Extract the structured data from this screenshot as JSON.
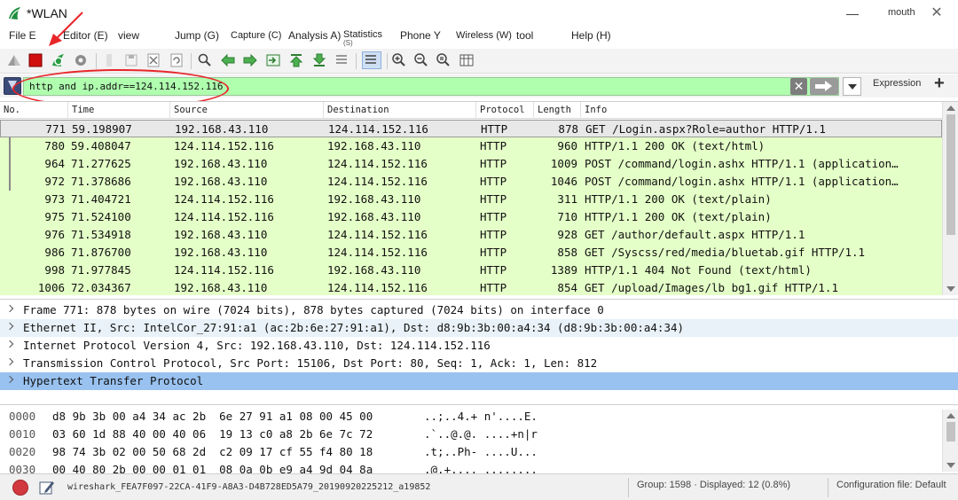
{
  "window": {
    "title": "*WLAN",
    "user": "mouth",
    "minimize_glyph": "—",
    "close_glyph": "✕"
  },
  "menu": {
    "file": "File E",
    "editor": "Editor (E)",
    "view": "view",
    "jump": "Jump (G)",
    "capture": "Capture (C)",
    "analysis": "Analysis A)",
    "statistics": "Statistics",
    "statistics_key": "(S)",
    "phone": "Phone Y",
    "wireless": "Wireless (W)",
    "tool": "tool",
    "help": "Help (H)"
  },
  "toolbar_icons": [
    "shark-fin-icon",
    "stop-capture-icon",
    "restart-capture-icon",
    "capture-options-icon",
    "open-file-icon",
    "save-file-icon",
    "close-file-icon",
    "reload-icon",
    "find-packet-icon",
    "go-back-icon",
    "go-forward-icon",
    "go-to-packet-icon",
    "go-first-icon",
    "go-last-icon",
    "autoscroll-icon",
    "colorize-icon",
    "zoom-in-icon",
    "zoom-out-icon",
    "zoom-normal-icon",
    "resize-columns-icon"
  ],
  "filter": {
    "value": "http and ip.addr==124.114.152.116",
    "clear_glyph": "✕",
    "expression_label": "Expression",
    "add_glyph": "+",
    "background": "#afffaf"
  },
  "packet_columns": [
    "No.",
    "Time",
    "Source",
    "Destination",
    "Protocol",
    "Length",
    "Info"
  ],
  "packets": [
    {
      "no": "771",
      "time": "59.198907",
      "src": "192.168.43.110",
      "dst": "124.114.152.116",
      "proto": "HTTP",
      "len": "878",
      "info": "GET /Login.aspx?Role=author HTTP/1.1",
      "selected": true
    },
    {
      "no": "780",
      "time": "59.408047",
      "src": "124.114.152.116",
      "dst": "192.168.43.110",
      "proto": "HTTP",
      "len": "960",
      "info": "HTTP/1.1 200 OK  (text/html)"
    },
    {
      "no": "964",
      "time": "71.277625",
      "src": "192.168.43.110",
      "dst": "124.114.152.116",
      "proto": "HTTP",
      "len": "1009",
      "info": "POST /command/login.ashx HTTP/1.1  (application…"
    },
    {
      "no": "972",
      "time": "71.378686",
      "src": "192.168.43.110",
      "dst": "124.114.152.116",
      "proto": "HTTP",
      "len": "1046",
      "info": "POST /command/login.ashx HTTP/1.1  (application…"
    },
    {
      "no": "973",
      "time": "71.404721",
      "src": "124.114.152.116",
      "dst": "192.168.43.110",
      "proto": "HTTP",
      "len": "311",
      "info": "HTTP/1.1 200 OK  (text/plain)"
    },
    {
      "no": "975",
      "time": "71.524100",
      "src": "124.114.152.116",
      "dst": "192.168.43.110",
      "proto": "HTTP",
      "len": "710",
      "info": "HTTP/1.1 200 OK  (text/plain)"
    },
    {
      "no": "976",
      "time": "71.534918",
      "src": "192.168.43.110",
      "dst": "124.114.152.116",
      "proto": "HTTP",
      "len": "928",
      "info": "GET /author/default.aspx HTTP/1.1"
    },
    {
      "no": "986",
      "time": "71.876700",
      "src": "192.168.43.110",
      "dst": "124.114.152.116",
      "proto": "HTTP",
      "len": "858",
      "info": "GET /Syscss/red/media/bluetab.gif HTTP/1.1"
    },
    {
      "no": "998",
      "time": "71.977845",
      "src": "124.114.152.116",
      "dst": "192.168.43.110",
      "proto": "HTTP",
      "len": "1389",
      "info": "HTTP/1.1 404 Not Found  (text/html)"
    },
    {
      "no": "1006",
      "time": "72.034367",
      "src": "192.168.43.110",
      "dst": "124.114.152.116",
      "proto": "HTTP",
      "len": "854",
      "info": "GET /upload/Images/lb bg1.gif HTTP/1.1"
    }
  ],
  "details": [
    {
      "text": "Frame 771: 878 bytes on wire (7024 bits), 878 bytes captured (7024 bits) on interface 0",
      "style": "plain"
    },
    {
      "text": "Ethernet II, Src: IntelCor_27:91:a1 (ac:2b:6e:27:91:a1), Dst: d8:9b:3b:00:a4:34 (d8:9b:3b:00:a4:34)",
      "style": "alt"
    },
    {
      "text": "Internet Protocol Version 4, Src: 192.168.43.110, Dst: 124.114.152.116",
      "style": "plain"
    },
    {
      "text": "Transmission Control Protocol, Src Port: 15106, Dst Port: 80, Seq: 1, Ack: 1, Len: 812",
      "style": "plain"
    },
    {
      "text": "Hypertext Transfer Protocol",
      "style": "selected"
    }
  ],
  "bytes": [
    {
      "offset": "0000",
      "hex": "d8 9b 3b 00 a4 34 ac 2b  6e 27 91 a1 08 00 45 00",
      "ascii": "..;..4.+ n'....E."
    },
    {
      "offset": "0010",
      "hex": "03 60 1d 88 40 00 40 06  19 13 c0 a8 2b 6e 7c 72",
      "ascii": ".`..@.@. ....+n|r"
    },
    {
      "offset": "0020",
      "hex": "98 74 3b 02 00 50 68 2d  c2 09 17 cf 55 f4 80 18",
      "ascii": ".t;..Ph- ....U..."
    },
    {
      "offset": "0030",
      "hex": "00 40 80 2b 00 00 01 01  08 0a 0b e9 a4 9d 04 8a",
      "ascii": ".@.+.... ........"
    }
  ],
  "status": {
    "file": "wireshark_FEA7F097-22CA-41F9-A8A3-D4B728ED5A79_20190920225212_a19852",
    "counts": "Group: 1598 · Displayed: 12 (0.8%)",
    "profile": "Configuration file: Default"
  },
  "colors": {
    "http_row": "#e4ffc7",
    "selected_detail": "#99c2f0",
    "annotation": "#e8262a"
  }
}
